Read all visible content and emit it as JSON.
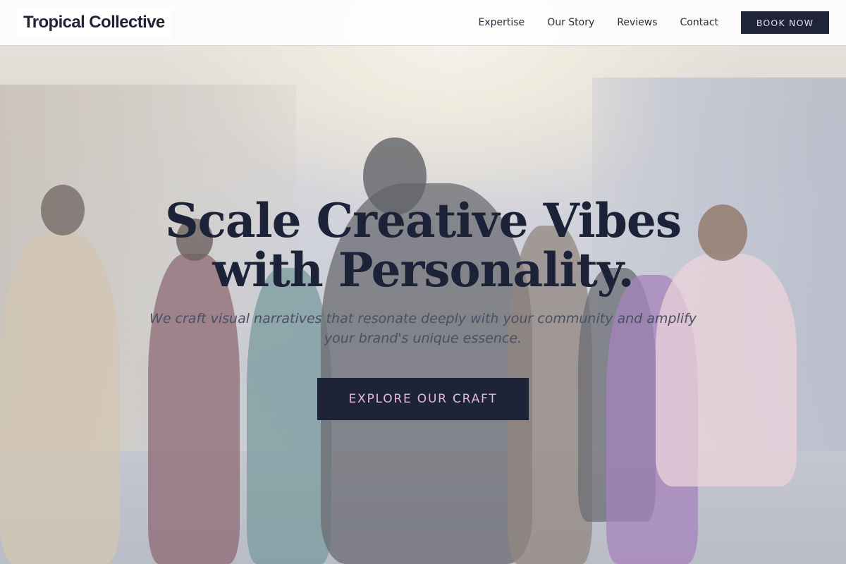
{
  "brand": {
    "name": "Tropical Collective"
  },
  "nav": {
    "items": [
      {
        "label": "Expertise"
      },
      {
        "label": "Our Story"
      },
      {
        "label": "Reviews"
      },
      {
        "label": "Contact"
      }
    ],
    "cta_label": "BOOK NOW"
  },
  "hero": {
    "headline": "Scale Creative Vibes with Personality.",
    "subheadline": "We craft visual narratives that resonate deeply with your community and amplify your brand's unique essence.",
    "cta_label": "EXPLORE OUR CRAFT",
    "background_image": "group-of-people-fashion-photo"
  },
  "colors": {
    "navy": "#1f2438",
    "cta_text": "#e8b9d3",
    "header_bg": "#ffffff"
  }
}
